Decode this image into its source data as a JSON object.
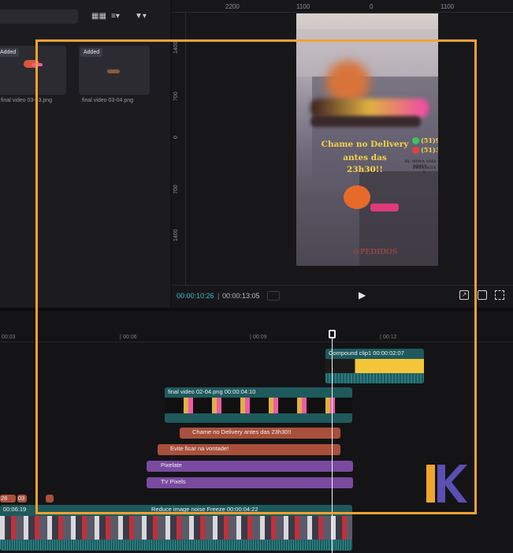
{
  "media": {
    "badge": "Added",
    "items": [
      {
        "name": "final video 03-03.png"
      },
      {
        "name": "final video 03-04.png"
      }
    ]
  },
  "player": {
    "ruler_top": [
      "2200",
      "1100",
      "0",
      "1100"
    ],
    "ruler_side": [
      "1400",
      "700",
      "0",
      "700",
      "1400"
    ],
    "current_time": "00:00:10:26",
    "total_time": "00:00:13:05",
    "preview": {
      "cta_line1": "Chame no Delivery",
      "cta_line2": "antes das",
      "cta_line3": "23h30!!",
      "phone_a": "(51)9",
      "phone_b": "(51)3",
      "address_a": "AV. NOVA VIEI SIQUI",
      "address_b": "ESTÂNCIA V",
      "footer": "@PEDIDOS"
    }
  },
  "timeline": {
    "ticks": [
      "00:03",
      "00:06",
      "00:09",
      "00:12"
    ],
    "clips": {
      "compound": "Compound clip1  00:00:02:07",
      "final_video": "final video 02-04.png  00:00:04:10",
      "text1": "Chame no Delivery  antes das  23h30!!",
      "text2": "Evite ficar na vontade!",
      "effect1": "Pixelate",
      "effect2": "TV Pixels",
      "main_time": "00:06:19",
      "main_effects": "Reduce image noise  Freeze  00:00:04:22",
      "small1": "28",
      "small2": "03"
    }
  },
  "colors": {
    "accent": "#f5a230",
    "timecode": "#38b8c8",
    "text_clip": "#a8503c",
    "effect_clip": "#7a4aa0",
    "video_clip": "#1e5a5c",
    "brand_yellow": "#f2a52c",
    "brand_purple": "#5b4fb2"
  },
  "brand": {
    "letter": "K"
  }
}
